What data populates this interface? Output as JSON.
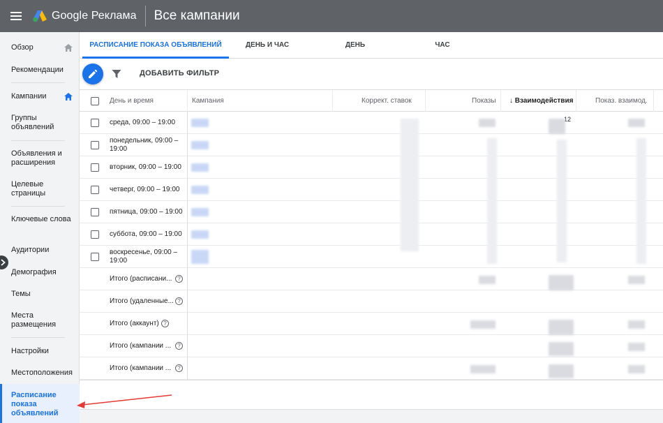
{
  "topbar": {
    "app_name": "Google Реклама",
    "page_title": "Все кампании"
  },
  "sidebar": {
    "items": [
      {
        "label": "Обзор"
      },
      {
        "label": "Рекомендации"
      },
      {
        "label": "Кампании"
      },
      {
        "label": "Группы объявлений"
      },
      {
        "label": "Объявления и расширения"
      },
      {
        "label": "Целевые страницы"
      },
      {
        "label": "Ключевые слова"
      },
      {
        "label": "Аудитории"
      },
      {
        "label": "Демография"
      },
      {
        "label": "Темы"
      },
      {
        "label": "Места размещения"
      },
      {
        "label": "Настройки"
      },
      {
        "label": "Местоположения"
      },
      {
        "label": "Расписание показа объявлений"
      }
    ]
  },
  "tabs": [
    {
      "label": "РАСПИСАНИЕ ПОКАЗА ОБЪЯВЛЕНИЙ"
    },
    {
      "label": "ДЕНЬ И ЧАС"
    },
    {
      "label": "ДЕНЬ"
    },
    {
      "label": "ЧАС"
    }
  ],
  "toolbar": {
    "add_filter": "ДОБАВИТЬ ФИЛЬТР"
  },
  "table": {
    "columns": {
      "day_time": "День и время",
      "campaign": "Кампания",
      "bid_adj": "Коррект. ставок",
      "impressions": "Показы",
      "interactions": "↓ Взаимодействия",
      "interaction_rate": "Показ. взаимод."
    },
    "rows": [
      {
        "label": "среда, 09:00 – 19:00",
        "interactions_partial": "12"
      },
      {
        "label": "понедельник, 09:00 – 19:00"
      },
      {
        "label": "вторник, 09:00 – 19:00"
      },
      {
        "label": "четверг, 09:00 – 19:00"
      },
      {
        "label": "пятница, 09:00 – 19:00"
      },
      {
        "label": "суббота, 09:00 – 19:00"
      },
      {
        "label": "воскресенье, 09:00 – 19:00"
      }
    ],
    "totals": [
      {
        "label": "Итого (расписани..."
      },
      {
        "label": "Итого (удаленные..."
      },
      {
        "label": "Итого (аккаунт)"
      },
      {
        "label": "Итого (кампании ..."
      },
      {
        "label": "Итого (кампании ..."
      }
    ],
    "help_glyph": "?"
  },
  "colors": {
    "accent": "#1a73e8",
    "topbar": "#5f6368",
    "annotation_arrow": "#e53935"
  }
}
